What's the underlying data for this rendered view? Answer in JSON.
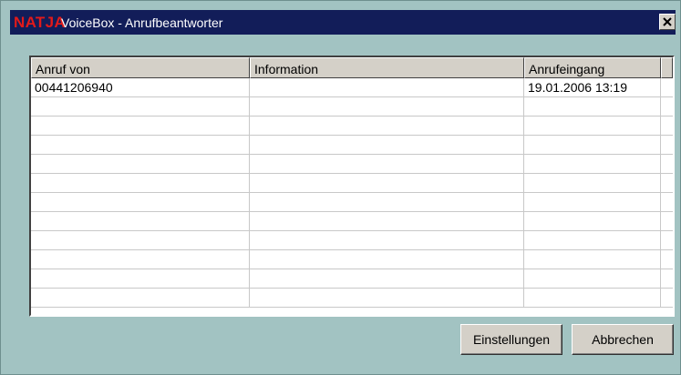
{
  "window": {
    "brand": "NATJA",
    "title": "VoiceBox - Anrufbeantworter",
    "close_glyph": "✕"
  },
  "table": {
    "columns": [
      "Anruf von",
      "Information",
      "Anrufeingang"
    ],
    "rows": [
      [
        "00441206940",
        "",
        "19.01.2006 13:19"
      ],
      [
        "",
        "",
        ""
      ],
      [
        "",
        "",
        ""
      ],
      [
        "",
        "",
        ""
      ],
      [
        "",
        "",
        ""
      ],
      [
        "",
        "",
        ""
      ],
      [
        "",
        "",
        ""
      ],
      [
        "",
        "",
        ""
      ],
      [
        "",
        "",
        ""
      ],
      [
        "",
        "",
        ""
      ],
      [
        "",
        "",
        ""
      ],
      [
        "",
        "",
        ""
      ]
    ]
  },
  "buttons": {
    "settings": "Einstellungen",
    "cancel": "Abbrechen"
  },
  "colors": {
    "background": "#a2c3c2",
    "titlebar": "#121d59",
    "brand": "#e21a1a"
  }
}
